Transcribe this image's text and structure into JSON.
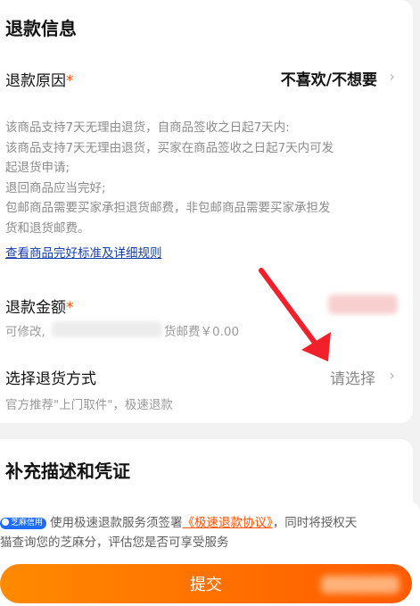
{
  "refund_info": {
    "title": "退款信息",
    "reason": {
      "label": "退款原因",
      "required_mark": "*",
      "value": "不喜欢/不想要",
      "chevron": "›"
    },
    "policy_lines": [
      "该商品支持7天无理由退货，自商品签收之日起7天内:",
      "该商品支持7天无理由退货，买家在商品签收之日起7天内可发",
      "起退货申请;",
      "退回商品应当完好;",
      "包邮商品需要买家承担退货邮费，非包邮商品需要买家承担发",
      "货和退货邮费。"
    ],
    "rules_link": "查看商品完好标准及详细规则",
    "amount": {
      "label": "退款金额",
      "required_mark": "*",
      "hint_prefix": "可修改,",
      "hint_suffix": "货邮费￥0.00"
    },
    "return_method": {
      "label": "选择退货方式",
      "value": "请选择",
      "chevron": "›",
      "hint": "官方推荐\"上门取件\"，极速退款"
    }
  },
  "supplement": {
    "title": "补充描述和凭证"
  },
  "footer": {
    "badge": "芝麻信用",
    "agreement_prefix": "使用极速退款服务须签署",
    "agreement_link": "《极速退款协议》",
    "agreement_suffix": "，同时将授权天",
    "agreement_line2": "猫查询您的芝麻分，评估您是否可享受服务",
    "submit_label": "提交"
  },
  "colors": {
    "accent": "#ff5000",
    "link": "#1740a8",
    "annotation_arrow": "#f2202a"
  }
}
